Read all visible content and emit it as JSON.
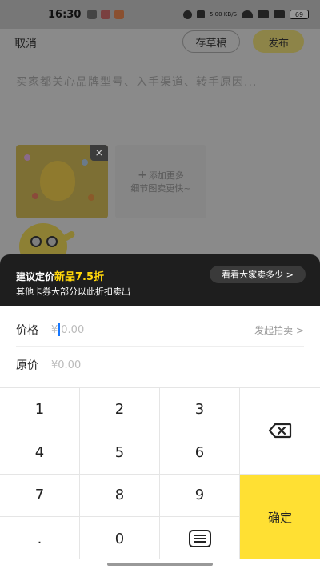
{
  "status_bar": {
    "time": "16:30",
    "net_speed": "5.00 KB/S",
    "battery": "69"
  },
  "header": {
    "cancel_label": "取消",
    "draft_label": "存草稿",
    "publish_label": "发布"
  },
  "description": {
    "placeholder": "买家都关心品牌型号、入手渠道、转手原因..."
  },
  "photos": {
    "close_symbol": "×",
    "add_more_line1": "添加更多",
    "add_more_line2": "细节图卖更快~",
    "plus_symbol": "+"
  },
  "tip": {
    "prefix": "建议定价",
    "highlight": "新品7.5折",
    "line2": "其他卡券大部分以此折扣卖出",
    "see_others": "看看大家卖多少 >"
  },
  "form": {
    "price_label": "价格",
    "price_currency": "¥",
    "price_placeholder": "0.00",
    "auction_label": "发起拍卖 >",
    "original_label": "原价",
    "original_placeholder": "¥0.00"
  },
  "keypad": {
    "keys": [
      "1",
      "2",
      "3",
      "4",
      "5",
      "6",
      "7",
      "8",
      "9",
      ".",
      "0"
    ],
    "confirm_label": "确定"
  },
  "colors": {
    "accent_yellow": "#ffe033",
    "tip_highlight": "#ffd60a",
    "tip_bg": "#1e1e1e",
    "cursor": "#1677ff"
  }
}
